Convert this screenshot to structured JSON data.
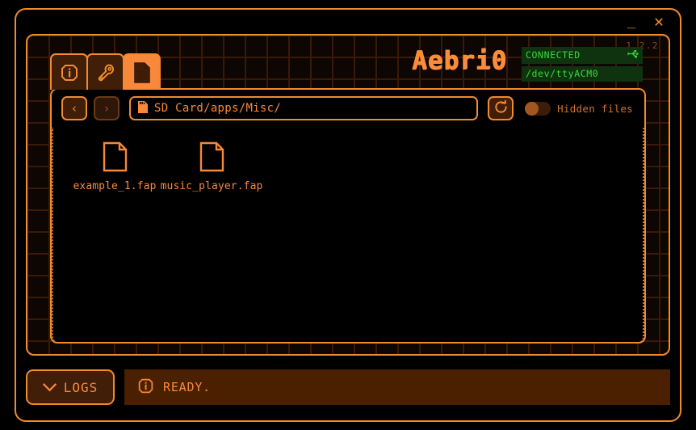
{
  "window": {
    "minimize_label": "_",
    "close_label": "✕",
    "version": "1.2.2"
  },
  "header": {
    "brand": "Aebri0",
    "connection": {
      "status_label": "CONNECTED",
      "usb_icon": "usb-icon",
      "port": "/dev/ttyACM0",
      "status_color": "#35d93a",
      "status_bg": "#10330f"
    }
  },
  "tabs": [
    {
      "name": "tab-info",
      "icon": "info-circle-icon",
      "active": false
    },
    {
      "name": "tab-tools",
      "icon": "wrench-icon",
      "active": false
    },
    {
      "name": "tab-files",
      "icon": "file-icon",
      "active": true
    }
  ],
  "toolbar": {
    "back_label": "‹",
    "forward_label": "›",
    "back_enabled": true,
    "forward_enabled": false,
    "path_icon": "sd-card-icon",
    "path_value": "SD Card/apps/Misc/",
    "path_placeholder": "SD Card/",
    "refresh_icon": "refresh-icon",
    "hidden_files_label": "Hidden files",
    "hidden_files_on": false
  },
  "files": [
    {
      "name": "example_1.fap",
      "icon": "file-icon"
    },
    {
      "name": "music_player.fap",
      "icon": "file-icon"
    }
  ],
  "footer": {
    "logs_label": "LOGS",
    "logs_icon": "chevron-down-icon",
    "status_icon": "info-circle-icon",
    "status_text": "READY."
  },
  "theme": {
    "accent": "#f08b2e",
    "accent_bright": "#f8883a",
    "panel_bg": "#0d0603",
    "grid_line": "#3a1a06",
    "tab_bg": "#401e08",
    "status_bg": "#4a2000"
  }
}
